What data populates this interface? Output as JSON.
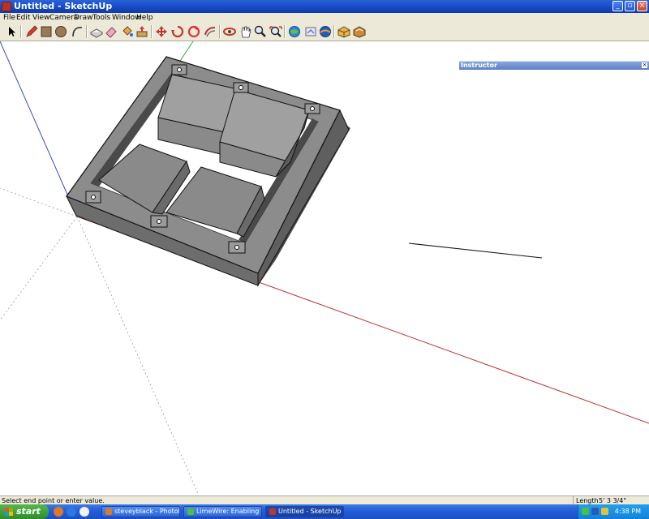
{
  "window": {
    "title": "Untitled - SketchUp"
  },
  "menu": [
    "File",
    "Edit",
    "View",
    "Camera",
    "Draw",
    "Tools",
    "Window",
    "Help"
  ],
  "toolbar": {
    "tools": [
      "select-tool-icon",
      "pencil-tool-icon",
      "rectangle-tool-icon",
      "circle-tool-icon",
      "arc-tool-icon",
      "make-component-icon",
      "eraser-tool-icon",
      "paint-bucket-icon",
      "push-pull-icon",
      "move-tool-icon",
      "rotate-tool-icon",
      "follow-me-icon",
      "offset-tool-icon",
      "orbit-tool-icon",
      "pan-tool-icon",
      "zoom-tool-icon",
      "zoom-extents-icon",
      "get-models-icon",
      "share-model-icon",
      "google-earth-icon",
      "components-icon",
      "materials-icon"
    ]
  },
  "instructor": {
    "title": "Instructor",
    "close": "×"
  },
  "status": {
    "message": "Select end point or enter value.",
    "length_label": "Length",
    "length_value": "5' 3 3/4\""
  },
  "taskbar": {
    "start": "start",
    "tasks": [
      {
        "label": "steveyblack - Photob..."
      },
      {
        "label": "LimeWire: Enabling O..."
      },
      {
        "label": "Untitled - SketchUp"
      }
    ],
    "clock": "4:38 PM"
  }
}
